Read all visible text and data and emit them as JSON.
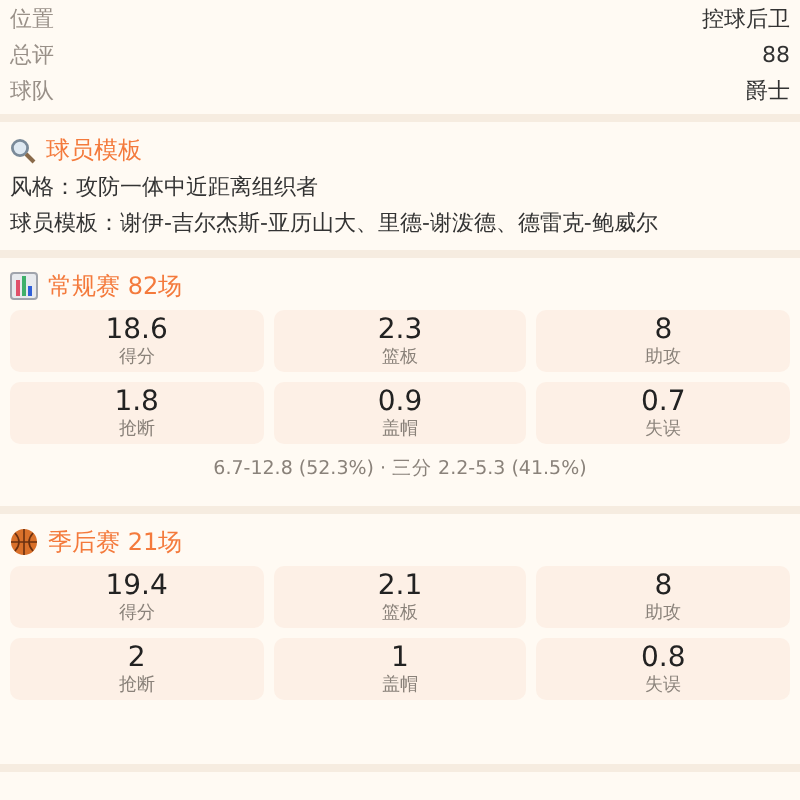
{
  "info": [
    {
      "label": "位置",
      "value": "控球后卫"
    },
    {
      "label": "总评",
      "value": "88"
    },
    {
      "label": "球队",
      "value": "爵士"
    }
  ],
  "template": {
    "title": "球员模板",
    "lines": [
      "风格：攻防一体中近距离组织者",
      "球员模板：谢伊-吉尔杰斯-亚历山大、里德-谢泼德、德雷克-鲍威尔"
    ]
  },
  "sections": [
    {
      "kind": "chart",
      "title": "常规赛 82场",
      "stats": [
        {
          "value": "18.6",
          "label": "得分"
        },
        {
          "value": "2.3",
          "label": "篮板"
        },
        {
          "value": "8",
          "label": "助攻"
        },
        {
          "value": "1.8",
          "label": "抢断"
        },
        {
          "value": "0.9",
          "label": "盖帽"
        },
        {
          "value": "0.7",
          "label": "失误"
        }
      ],
      "note": "6.7-12.8 (52.3%) · 三分 2.2-5.3 (41.5%)"
    },
    {
      "kind": "ball",
      "title": "季后赛 21场",
      "stats": [
        {
          "value": "19.4",
          "label": "得分"
        },
        {
          "value": "2.1",
          "label": "篮板"
        },
        {
          "value": "8",
          "label": "助攻"
        },
        {
          "value": "2",
          "label": "抢断"
        },
        {
          "value": "1",
          "label": "盖帽"
        },
        {
          "value": "0.8",
          "label": "失误"
        }
      ]
    }
  ]
}
